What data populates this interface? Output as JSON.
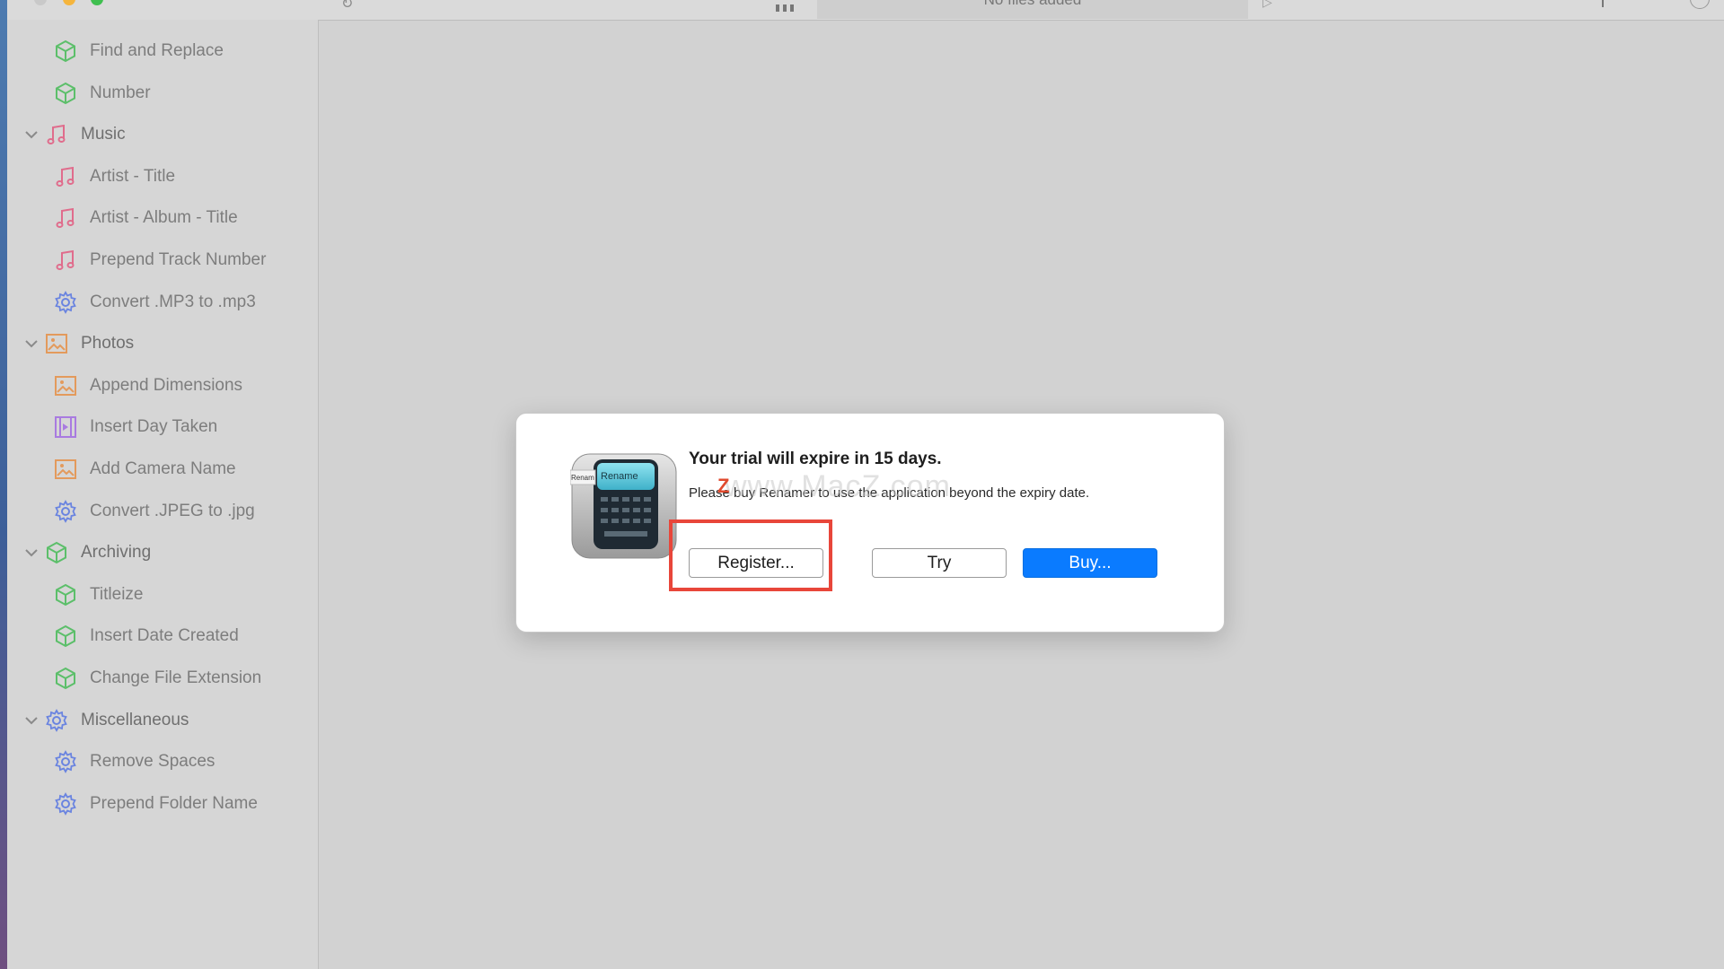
{
  "toolbar": {
    "status": "No files added"
  },
  "sidebar": {
    "items": [
      {
        "label": "Find and Replace",
        "icon": "cube-icon",
        "color": "#5cbf6a",
        "group": false
      },
      {
        "label": "Number",
        "icon": "cube-icon",
        "color": "#5cbf6a",
        "group": false
      },
      {
        "label": "Music",
        "icon": "music-note-icon",
        "color": "#e06c8c",
        "group": true
      },
      {
        "label": "Artist - Title",
        "icon": "music-note-icon",
        "color": "#e06c8c",
        "group": false
      },
      {
        "label": "Artist - Album - Title",
        "icon": "music-note-icon",
        "color": "#e06c8c",
        "group": false
      },
      {
        "label": "Prepend Track Number",
        "icon": "music-note-icon",
        "color": "#e06c8c",
        "group": false
      },
      {
        "label": "Convert .MP3 to .mp3",
        "icon": "gear-icon",
        "color": "#6a84e0",
        "group": false
      },
      {
        "label": "Photos",
        "icon": "photo-icon",
        "color": "#e39a5c",
        "group": true
      },
      {
        "label": "Append Dimensions",
        "icon": "photo-icon",
        "color": "#e39a5c",
        "group": false
      },
      {
        "label": "Insert Day Taken",
        "icon": "film-icon",
        "color": "#a97be0",
        "group": false
      },
      {
        "label": "Add Camera Name",
        "icon": "photo-icon",
        "color": "#e39a5c",
        "group": false
      },
      {
        "label": "Convert .JPEG to .jpg",
        "icon": "gear-icon",
        "color": "#6a84e0",
        "group": false
      },
      {
        "label": "Archiving",
        "icon": "cube-icon",
        "color": "#5cbf6a",
        "group": true
      },
      {
        "label": "Titleize",
        "icon": "cube-icon",
        "color": "#5cbf6a",
        "group": false
      },
      {
        "label": "Insert Date Created",
        "icon": "cube-icon",
        "color": "#5cbf6a",
        "group": false
      },
      {
        "label": "Change File Extension",
        "icon": "cube-icon",
        "color": "#5cbf6a",
        "group": false
      },
      {
        "label": "Miscellaneous",
        "icon": "gear-icon",
        "color": "#6a84e0",
        "group": true
      },
      {
        "label": "Remove Spaces",
        "icon": "gear-icon",
        "color": "#6a84e0",
        "group": false
      },
      {
        "label": "Prepend Folder Name",
        "icon": "gear-icon",
        "color": "#6a84e0",
        "group": false
      }
    ]
  },
  "dialog": {
    "title": "Your trial will expire in 15 days.",
    "message": "Please buy Renamer to use the application beyond the expiry date.",
    "watermark": "www.MacZ.com",
    "watermark_logo": "Z",
    "app_icon_text": "Rename",
    "app_icon_tab": "Renam",
    "buttons": {
      "register": "Register...",
      "try": "Try",
      "buy": "Buy..."
    },
    "accent_color": "#0a7bff",
    "highlight_color": "#e8463a"
  }
}
